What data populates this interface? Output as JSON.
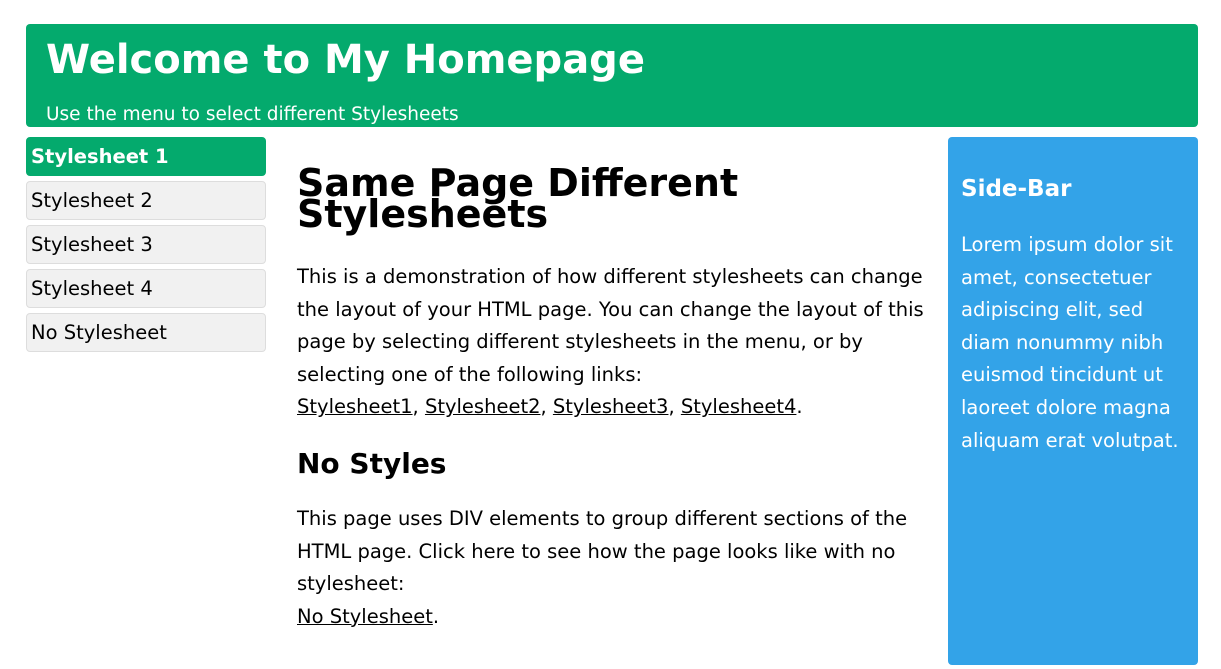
{
  "header": {
    "title": "Welcome to My Homepage",
    "subtitle": "Use the menu to select different Stylesheets"
  },
  "menu": {
    "items": [
      {
        "label": "Stylesheet 1",
        "active": true
      },
      {
        "label": "Stylesheet 2",
        "active": false
      },
      {
        "label": "Stylesheet 3",
        "active": false
      },
      {
        "label": "Stylesheet 4",
        "active": false
      },
      {
        "label": "No Stylesheet",
        "active": false
      }
    ]
  },
  "main": {
    "heading": "Same Page Different Stylesheets",
    "para1_text": "This is a demonstration of how different stylesheets can change the layout of your HTML page. You can change the layout of this page by selecting different stylesheets in the menu, or by selecting one of the following links:",
    "links": [
      "Stylesheet1",
      "Stylesheet2",
      "Stylesheet3",
      "Stylesheet4"
    ],
    "link_separator": ", ",
    "para1_end": ".",
    "subheading": "No Styles",
    "para2_text": "This page uses DIV elements to group different sections of the HTML page. Click here to see how the page looks like with no stylesheet:",
    "no_style_link": "No Stylesheet",
    "para2_end": "."
  },
  "sidebar": {
    "title": "Side-Bar",
    "text": "Lorem ipsum dolor sit amet, consectetuer adipiscing elit, sed diam nonummy nibh euismod tincidunt ut laoreet dolore magna aliquam erat volutpat."
  },
  "colors": {
    "header_bg": "#04aa6d",
    "menu_active_bg": "#04aa6d",
    "menu_bg": "#f1f1f1",
    "sidebar_bg": "#33a3e8"
  }
}
